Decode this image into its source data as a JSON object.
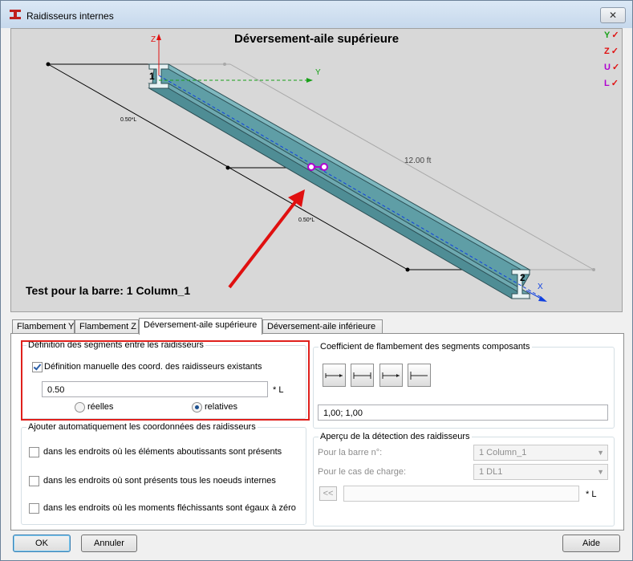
{
  "window": {
    "title": "Raidisseurs internes",
    "close_label": "✕"
  },
  "viewport": {
    "title": "Déversement-aile supérieure",
    "caption": "Test pour la barre: 1 Column_1",
    "axes_legend": [
      "Y",
      "Z",
      "U",
      "L"
    ],
    "dimension_label": "12.00  ft",
    "ratio_top": "0.50*L",
    "ratio_bottom": "0.50*L",
    "node_start": "1",
    "node_end": "2",
    "axis_z": "Z",
    "axis_y": "Y",
    "axis_x": "X",
    "colors": {
      "beam": "#5f9ea6",
      "arrow": "#e01010",
      "stiffener": "#b000d0",
      "axis": "#1040e0"
    }
  },
  "tabs": [
    {
      "label": "Flambement Y",
      "active": false
    },
    {
      "label": "Flambement Z",
      "active": false
    },
    {
      "label": "Déversement-aile supérieure",
      "active": true
    },
    {
      "label": "Déversement-aile inférieure",
      "active": false
    }
  ],
  "segments": {
    "group_label": "Définition des segments entre les raidisseurs",
    "manual_label": "Définition manuelle des coord. des raidisseurs existants",
    "manual_checked": true,
    "coords_value": "0.50",
    "unit_label": "* L",
    "radio_real": "réelles",
    "radio_relative": "relatives",
    "selected": "relatives"
  },
  "auto": {
    "group_label": "Ajouter automatiquement les coordonnées des raidisseurs",
    "options": [
      {
        "label": "dans les endroits où les éléments aboutissants sont présents",
        "checked": false
      },
      {
        "label": "dans les endroits où sont présents tous les noeuds internes",
        "checked": false
      },
      {
        "label": "dans les endroits où les moments fléchissants sont égaux à zéro",
        "checked": false
      }
    ]
  },
  "coefficient": {
    "group_label": "Coefficient de flambement des segments composants",
    "value": "1,00; 1,00"
  },
  "preview": {
    "group_label": "Aperçu de la détection des raidisseurs",
    "bar_label": "Pour la barre n°:",
    "bar_value": "1 Column_1",
    "load_label": "Pour le cas de charge:",
    "load_value": "1 DL1",
    "back_button": "<<",
    "unit_label": "* L"
  },
  "buttons": {
    "ok": "OK",
    "cancel": "Annuler",
    "help": "Aide"
  }
}
